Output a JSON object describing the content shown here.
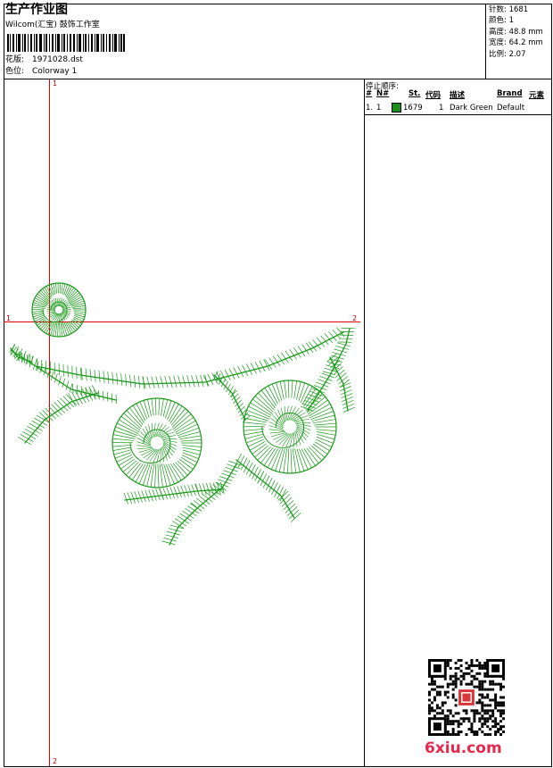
{
  "header": {
    "title": "生产作业图",
    "subtitle": "Wilcom(汇宝) 鼓饰工作室",
    "design_label": "花版:",
    "design_value": "1971028.dst",
    "colorway_label": "色位:",
    "colorway_value": "Colorway 1"
  },
  "stats": {
    "stitches": "针数: 1681",
    "colors": "颜色: 1",
    "height": "高度: 48.8 mm",
    "width": "宽度: 64.2 mm",
    "scale": "比例: 2.07"
  },
  "stop_sequence": {
    "label": "停止顺序:",
    "headers": {
      "num": "#",
      "needle": "N#",
      "st": "St.",
      "code": "代码",
      "desc": "描述",
      "brand": "Brand",
      "element": "元素"
    },
    "rows": [
      {
        "num": "1.",
        "needle": "1",
        "st": "1679",
        "code": "1",
        "desc": "Dark Green",
        "brand": "Default",
        "color": "#1a8f1a"
      }
    ]
  },
  "guides": {
    "v_top": "1",
    "v_bottom": "2",
    "h_left": "1",
    "h_right": "2"
  },
  "design_color": "#1a9a1a",
  "watermark": "6xiu.com"
}
